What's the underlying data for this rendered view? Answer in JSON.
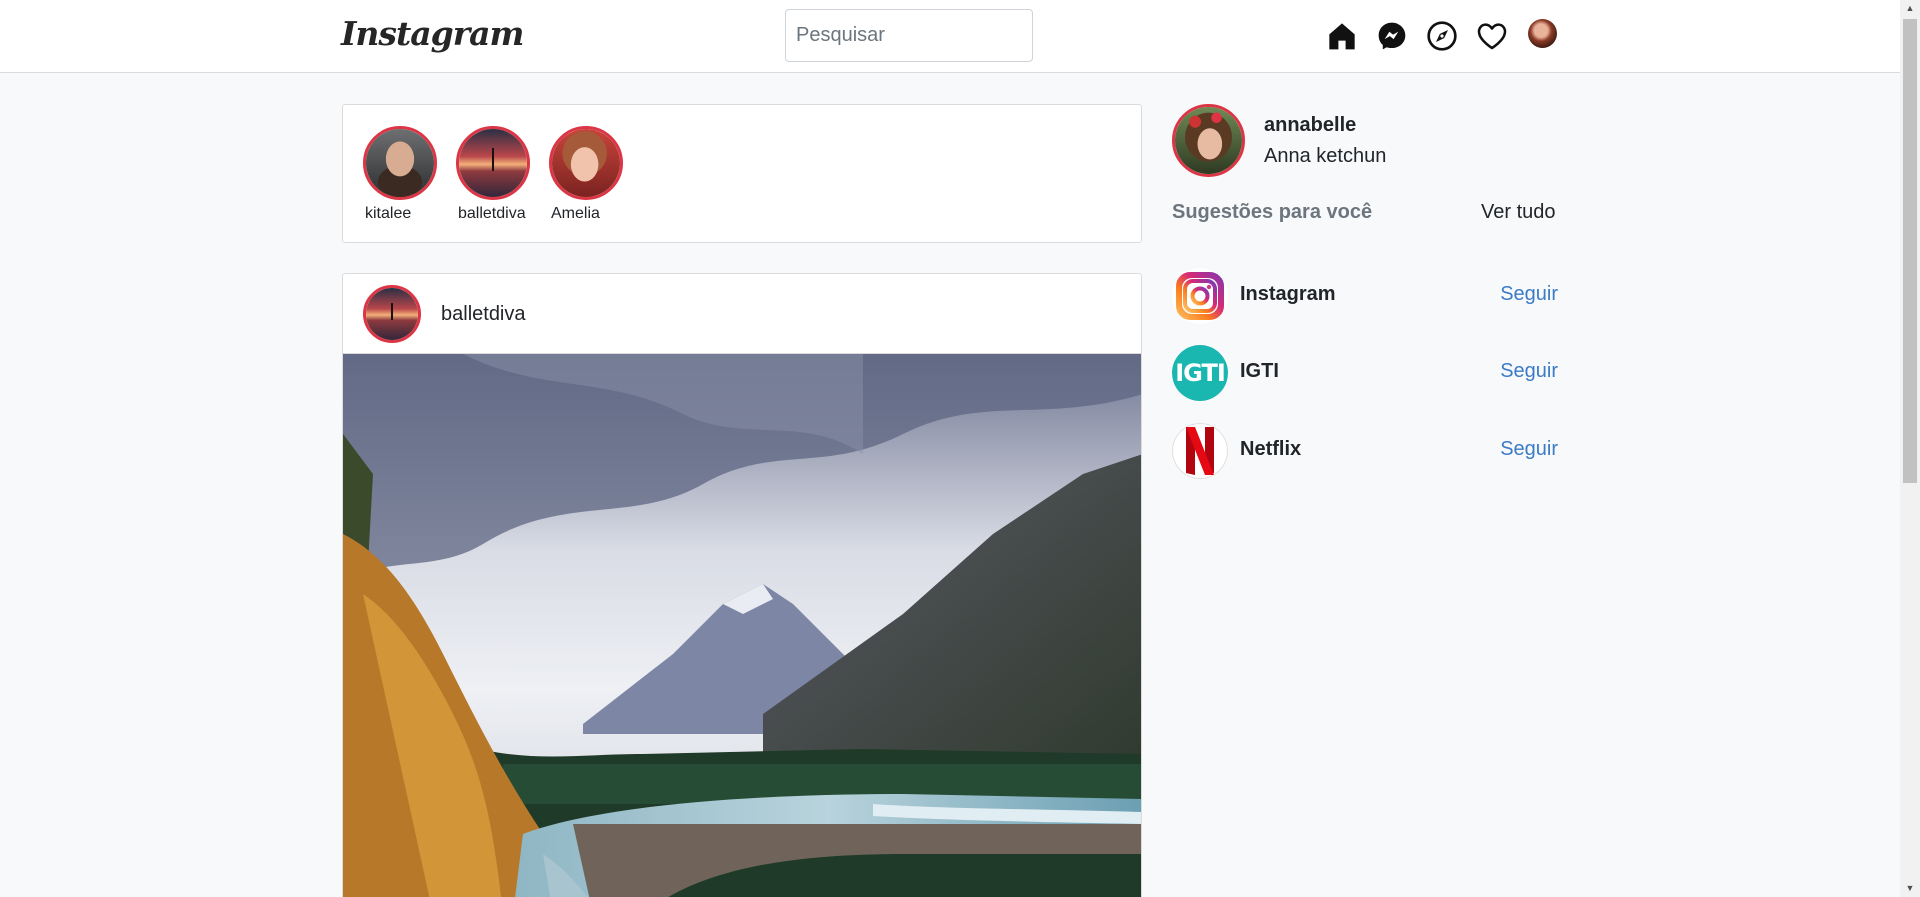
{
  "navbar": {
    "logo": "Instagram",
    "search_placeholder": "Pesquisar",
    "icons": [
      "home-icon",
      "messenger-icon",
      "explore-icon",
      "heart-icon"
    ]
  },
  "stories": [
    {
      "username": "kitalee"
    },
    {
      "username": "balletdiva"
    },
    {
      "username": "Amelia"
    }
  ],
  "post": {
    "username": "balletdiva"
  },
  "profile": {
    "username": "annabelle",
    "name": "Anna ketchun"
  },
  "suggestions": {
    "title": "Sugestões para você",
    "see_all": "Ver tudo",
    "items": [
      {
        "name": "Instagram",
        "action": "Seguir",
        "logo": "instagram-logo"
      },
      {
        "name": "IGTI",
        "action": "Seguir",
        "logo": "igti-logo",
        "logo_text": "IGTI"
      },
      {
        "name": "Netflix",
        "action": "Seguir",
        "logo": "netflix-logo"
      }
    ]
  },
  "colors": {
    "story_ring": "#dc3545",
    "follow_link": "#3b7bc7",
    "igti_brand": "#19b7b0",
    "netflix_brand": "#e50914"
  }
}
